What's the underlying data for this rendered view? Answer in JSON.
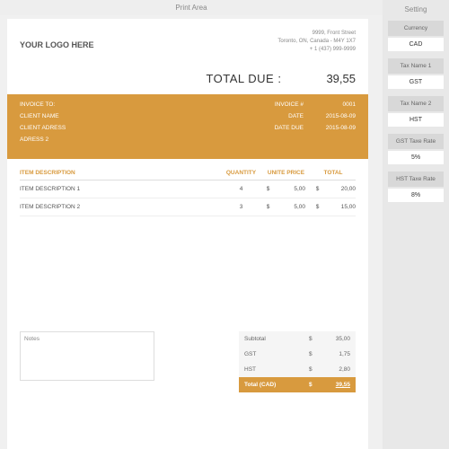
{
  "tabs": {
    "main": "Print Area",
    "side": "Setting"
  },
  "logo": "YOUR LOGO HERE",
  "address": {
    "line1": "9999, Front Street",
    "line2": "Toronto, ON, Canada - M4Y 1X7",
    "phone": "+ 1 (437) 999-9999"
  },
  "total_due": {
    "label": "TOTAL DUE :",
    "value": "39,55"
  },
  "orange": {
    "invoice_to": "INVOICE TO:",
    "client_name": "CLIENT NAME",
    "client_address": "CLIENT ADRESS",
    "address2": "ADRESS 2",
    "invoice_num_label": "INVOICE #",
    "invoice_num": "0001",
    "date_label": "DATE",
    "date": "2015-08-09",
    "date_due_label": "DATE DUE",
    "date_due": "2015-08-09"
  },
  "items": {
    "headers": {
      "desc": "ITEM DESCRIPTION",
      "qty": "QUANTITY",
      "price": "UNITE PRICE",
      "total": "TOTAL"
    },
    "currency": "$",
    "rows": [
      {
        "desc": "ITEM DESCRIPTION 1",
        "qty": "4",
        "price": "5,00",
        "total": "20,00"
      },
      {
        "desc": "ITEM DESCRIPTION 2",
        "qty": "3",
        "price": "5,00",
        "total": "15,00"
      }
    ]
  },
  "notes_label": "Notes",
  "summary": {
    "subtotal_label": "Subtotal",
    "subtotal": "35,00",
    "gst_label": "GST",
    "gst": "1,75",
    "hst_label": "HST",
    "hst": "2,80",
    "total_label": "Total (CAD)",
    "total": "39,55",
    "currency": "$"
  },
  "settings": {
    "currency": {
      "label": "Currency",
      "value": "CAD"
    },
    "tax1": {
      "label": "Tax Name 1",
      "value": "GST"
    },
    "tax2": {
      "label": "Tax Name 2",
      "value": "HST"
    },
    "gst_rate": {
      "label": "GST Taxe Rate",
      "value": "5%"
    },
    "hst_rate": {
      "label": "HST Taxe Rate",
      "value": "8%"
    }
  }
}
